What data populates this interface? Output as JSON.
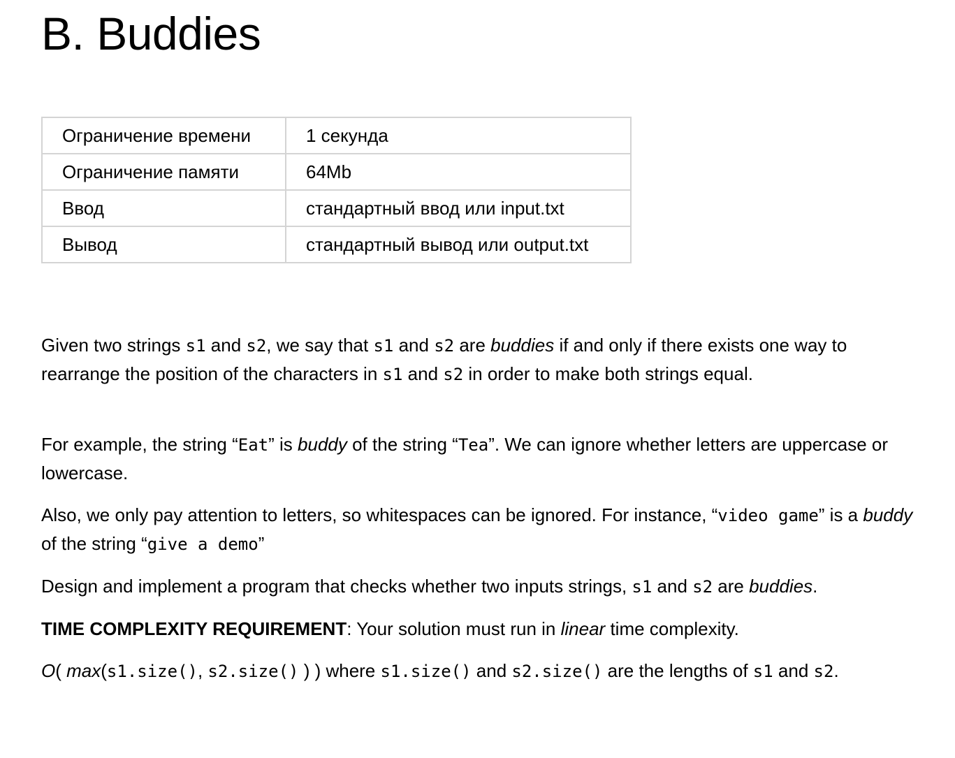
{
  "problem": {
    "title": "B. Buddies"
  },
  "limits": [
    {
      "label": "Ограничение времени",
      "value": "1 секунда"
    },
    {
      "label": "Ограничение памяти",
      "value": "64Mb"
    },
    {
      "label": "Ввод",
      "value": "стандартный ввод или input.txt"
    },
    {
      "label": "Вывод",
      "value": "стандартный вывод или output.txt"
    }
  ],
  "statement": {
    "p1": {
      "t1": "Given two strings ",
      "c1": "s1",
      "t2": " and ",
      "c2": "s2",
      "t3": ", we say that ",
      "c3": "s1",
      "t4": " and ",
      "c4": "s2",
      "t5": " are ",
      "em1": "buddies",
      "t6": " if and only if there exists one way to rearrange the position of the characters in ",
      "c5": "s1",
      "t7": " and ",
      "c6": "s2",
      "t8": " in order to make both strings equal."
    },
    "p2": {
      "t1": "For example, the string “",
      "c1": "Eat",
      "t2": "” is ",
      "em1": "buddy",
      "t3": " of the string “",
      "c2": "Tea",
      "t4": "”. We can ignore whether letters are uppercase or lowercase."
    },
    "p3": {
      "t1": "Also, we only pay attention to letters, so whitespaces can be ignored. For instance, “",
      "c1": "video game",
      "t2": "” is a ",
      "em1": "buddy",
      "t3": " of the string “",
      "c2": "give a demo",
      "t4": "”"
    },
    "p4": {
      "t1": "Design and implement a program that checks whether two inputs strings, ",
      "c1": "s1",
      "t2": " and ",
      "c2": "s2",
      "t3": " are ",
      "em1": "buddies",
      "t4": "."
    },
    "p5": {
      "b1": "TIME COMPLEXITY REQUIREMENT",
      "t1": ": Your solution must run in ",
      "em1": "linear",
      "t2": " time complexity."
    },
    "p6": {
      "em1": "O",
      "t1": "( ",
      "em2": "max",
      "t2": "(",
      "c1": "s1.size()",
      "t3": ", ",
      "c2": "s2.size()",
      "t4": " ) ) where ",
      "c3": "s1.size()",
      "t5": " and ",
      "c4": "s2.size()",
      "t6": " are the lengths of ",
      "c5": "s1",
      "t7": " and ",
      "c6": "s2",
      "t8": "."
    }
  }
}
